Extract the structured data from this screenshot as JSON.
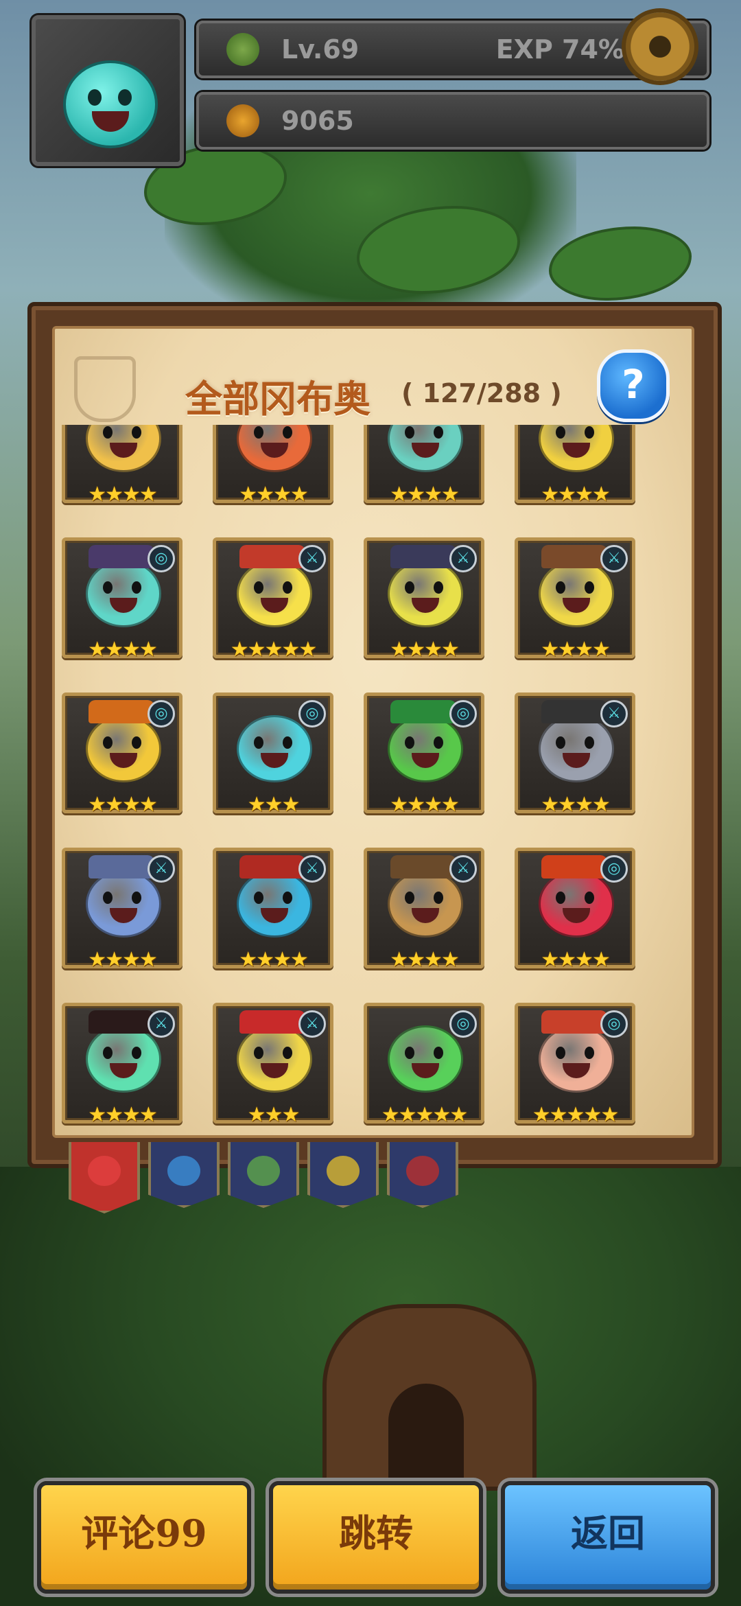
{
  "hud": {
    "level_text": "Lv.69",
    "exp_text": "EXP 74%",
    "exp_fraction": 0.74,
    "coins_text": "9065"
  },
  "panel": {
    "title": "全部冈布奥",
    "count_text": "( 127/288 )",
    "help_label": "?"
  },
  "collection": {
    "rows": [
      [
        {
          "stars": "★★★★",
          "color": "#f0c04a",
          "badge": ""
        },
        {
          "stars": "★★★★",
          "color": "#e86a3a",
          "badge": ""
        },
        {
          "stars": "★★★★",
          "color": "#6ad0c0",
          "badge": ""
        },
        {
          "stars": "★★★★",
          "color": "#f0d040",
          "badge": ""
        }
      ],
      [
        {
          "stars": "★★★★",
          "color": "#5fd6c8",
          "badge": "◎",
          "hat": "#4a3a6a"
        },
        {
          "stars": "★★★★★",
          "color": "#f6e04a",
          "badge": "⚔",
          "hat": "#c23a2a"
        },
        {
          "stars": "★★★★",
          "color": "#e8e04a",
          "badge": "⚔",
          "hat": "#3a3a5a"
        },
        {
          "stars": "★★★★",
          "color": "#f0d848",
          "badge": "⚔",
          "hat": "#7a4a2a"
        }
      ],
      [
        {
          "stars": "★★★★",
          "color": "#f2c83a",
          "badge": "◎",
          "hat": "#d26a1a"
        },
        {
          "stars": "★★★",
          "color": "#4fd3de",
          "badge": "◎",
          "hat": ""
        },
        {
          "stars": "★★★★",
          "color": "#58c84a",
          "badge": "◎",
          "hat": "#2a8a3a"
        },
        {
          "stars": "★★★★",
          "color": "#9aa0ae",
          "badge": "⚔",
          "hat": "#333333"
        }
      ],
      [
        {
          "stars": "★★★★",
          "color": "#7a9ad8",
          "badge": "⚔",
          "hat": "#5a6a9a"
        },
        {
          "stars": "★★★★",
          "color": "#3bb6e0",
          "badge": "⚔",
          "hat": "#b02a22"
        },
        {
          "stars": "★★★★",
          "color": "#c79650",
          "badge": "⚔",
          "hat": "#6a4a2a"
        },
        {
          "stars": "★★★★",
          "color": "#e0304a",
          "badge": "◎",
          "hat": "#d0401a"
        }
      ],
      [
        {
          "stars": "★★★★",
          "color": "#5fe0b0",
          "badge": "⚔",
          "hat": "#2a1a1a"
        },
        {
          "stars": "★★★",
          "color": "#f0d648",
          "badge": "⚔",
          "hat": "#c82a2a"
        },
        {
          "stars": "★★★★★",
          "color": "#58d05a",
          "badge": "◎",
          "hat": ""
        },
        {
          "stars": "★★★★★",
          "color": "#f0b098",
          "badge": "◎",
          "hat": "#c8402a"
        }
      ],
      [
        {
          "stars": "",
          "color": "#6a6a6a",
          "badge": "⚔"
        },
        {
          "stars": "",
          "color": "#6a6a6a",
          "badge": "⚔"
        },
        {
          "stars": "",
          "color": "#6a6a6a",
          "badge": "◎"
        },
        {
          "stars": "",
          "color": "#6a6a6a",
          "badge": "◎"
        }
      ]
    ]
  },
  "tabs": [
    {
      "name": "all",
      "color": "#e04040",
      "active": true
    },
    {
      "name": "blue",
      "color": "#3a8ad0",
      "active": false
    },
    {
      "name": "green",
      "color": "#5aa04a",
      "active": false
    },
    {
      "name": "yellow",
      "color": "#d0b030",
      "active": false
    },
    {
      "name": "red",
      "color": "#b03030",
      "active": false
    }
  ],
  "buttons": {
    "comment_label": "评论99",
    "jump_label": "跳转",
    "back_label": "返回"
  },
  "icons": {
    "settings": "gear-icon",
    "help": "question-icon",
    "level": "leaf-icon",
    "coins": "gold-sprout-icon"
  }
}
